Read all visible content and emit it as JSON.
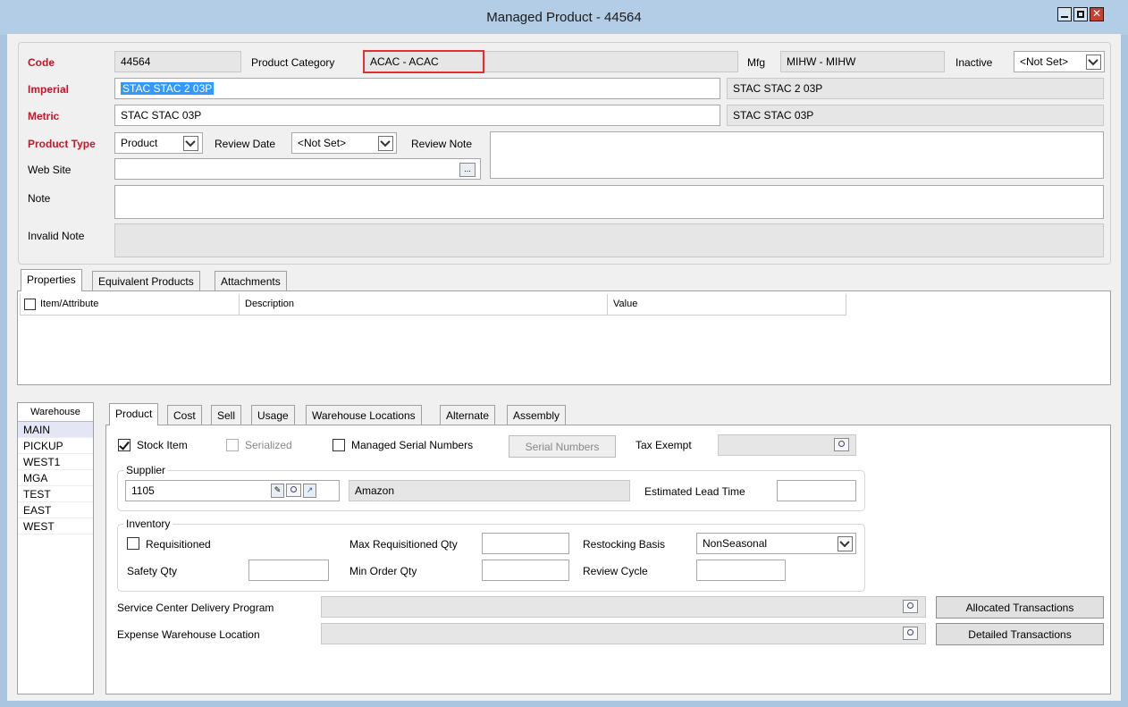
{
  "window": {
    "title": "Managed Product - 44564",
    "min_label": "–",
    "max_label": "□",
    "close_label": "✕"
  },
  "header": {
    "code_label": "Code",
    "code_value": "44564",
    "category_label": "Product Category",
    "category_value": "ACAC - ACAC",
    "mfg_label": "Mfg",
    "mfg_value": "MIHW - MIHW",
    "inactive_label": "Inactive",
    "inactive_value": "<Not Set>",
    "imperial_label": "Imperial",
    "imperial_value": "STAC STAC 2 03P",
    "imperial_readonly": "STAC STAC 2 03P",
    "metric_label": "Metric",
    "metric_value": "STAC STAC 03P",
    "metric_readonly": "STAC STAC 03P",
    "product_type_label": "Product Type",
    "product_type_value": "Product",
    "review_date_label": "Review Date",
    "review_date_value": "<Not Set>",
    "review_note_label": "Review Note",
    "review_note_value": "",
    "website_label": "Web Site",
    "website_value": "",
    "website_btn": "...",
    "note_label": "Note",
    "note_value": "",
    "invalid_note_label": "Invalid Note",
    "invalid_note_value": ""
  },
  "upper_tabs": [
    "Properties",
    "Equivalent Products",
    "Attachments"
  ],
  "properties_grid": {
    "columns": [
      "Item/Attribute",
      "Description",
      "Value"
    ],
    "rows": []
  },
  "warehouses": {
    "header": "Warehouse",
    "items": [
      "MAIN",
      "PICKUP",
      "WEST1",
      "MGA",
      "TEST",
      "EAST",
      "WEST"
    ],
    "selected": "MAIN"
  },
  "lower_tabs": [
    "Product",
    "Cost",
    "Sell",
    "Usage",
    "Warehouse Locations",
    "Alternate",
    "Assembly"
  ],
  "product_tab": {
    "stock_item_label": "Stock Item",
    "stock_item_checked": true,
    "serialized_label": "Serialized",
    "serialized_checked": false,
    "managed_serial_label": "Managed Serial Numbers",
    "managed_serial_checked": false,
    "serial_numbers_btn": "Serial Numbers",
    "tax_exempt_label": "Tax Exempt",
    "tax_exempt_value": "",
    "supplier_group": "Supplier",
    "supplier_code": "1105",
    "supplier_name": "Amazon",
    "lead_time_label": "Estimated Lead Time",
    "lead_time_value": "",
    "inventory_group": "Inventory",
    "requisitioned_label": "Requisitioned",
    "requisitioned_checked": false,
    "max_req_label": "Max Requisitioned Qty",
    "max_req_value": "",
    "restocking_label": "Restocking Basis",
    "restocking_value": "NonSeasonal",
    "safety_label": "Safety Qty",
    "safety_value": "",
    "min_order_label": "Min Order Qty",
    "min_order_value": "",
    "review_cycle_label": "Review Cycle",
    "review_cycle_value": "",
    "scdp_label": "Service Center Delivery Program",
    "scdp_value": "",
    "ewl_label": "Expense Warehouse Location",
    "ewl_value": "",
    "allocated_btn": "Allocated Transactions",
    "detailed_btn": "Detailed Transactions"
  },
  "colors": {
    "required_label": "#c4172b",
    "selection": "#3399ff",
    "highlight_border": "#e03030",
    "title_bar": "#b3cde6"
  }
}
